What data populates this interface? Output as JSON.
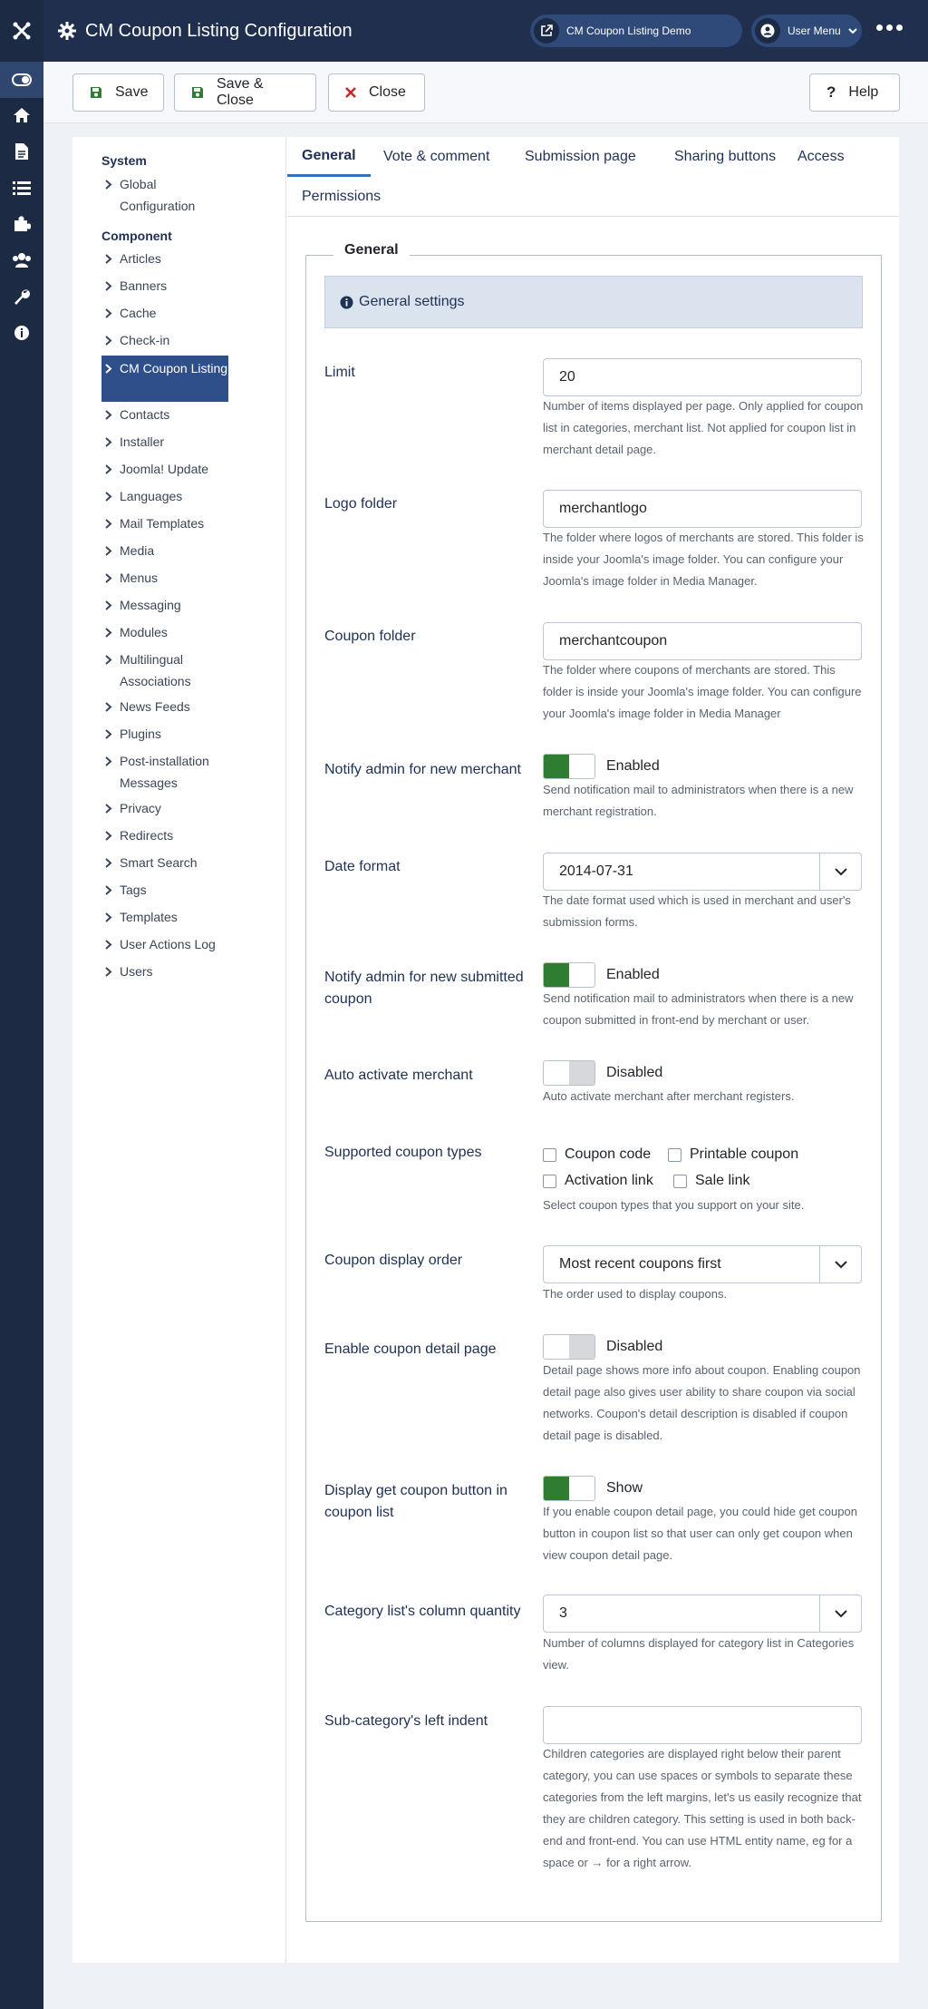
{
  "header": {
    "title": "CM Coupon Listing Configuration",
    "demo_link": "CM Coupon Listing Demo",
    "user_menu": "User Menu"
  },
  "toolbar": {
    "save": "Save",
    "save_close": "Save & Close",
    "close": "Close",
    "help": "Help"
  },
  "sidebar": {
    "system_heading": "System",
    "global_config": "Global Configuration",
    "component_heading": "Component",
    "items": [
      "Articles",
      "Banners",
      "Cache",
      "Check-in",
      "CM Coupon Listing",
      "Contacts",
      "Installer",
      "Joomla! Update",
      "Languages",
      "Mail Templates",
      "Media",
      "Menus",
      "Messaging",
      "Modules",
      "Multilingual Associations",
      "News Feeds",
      "Plugins",
      "Post-installation Messages",
      "Privacy",
      "Redirects",
      "Smart Search",
      "Tags",
      "Templates",
      "User Actions Log",
      "Users"
    ]
  },
  "tabs": [
    "General",
    "Vote & comment",
    "Submission page",
    "Sharing buttons",
    "Access",
    "Permissions"
  ],
  "form": {
    "legend": "General",
    "alert": "General settings",
    "limit": {
      "label": "Limit",
      "value": "20",
      "desc": "Number of items displayed per page. Only applied for coupon list in categories, merchant list. Not applied for coupon list in merchant detail page."
    },
    "logo_folder": {
      "label": "Logo folder",
      "value": "merchantlogo",
      "desc": "The folder where logos of merchants are stored. This folder is inside your Joomla's image folder. You can configure your Joomla's image folder in Media Manager."
    },
    "coupon_folder": {
      "label": "Coupon folder",
      "value": "merchantcoupon",
      "desc": "The folder where coupons of merchants are stored. This folder is inside your Joomla's image folder. You can configure your Joomla's image folder in Media Manager"
    },
    "notify_merchant": {
      "label": "Notify admin for new merchant",
      "state": "Enabled",
      "on": true,
      "desc": "Send notification mail to administrators when there is a new merchant registration."
    },
    "date_format": {
      "label": "Date format",
      "value": "2014-07-31",
      "desc": "The date format used which is used in merchant and user's submission forms."
    },
    "notify_coupon": {
      "label": "Notify admin for new submitted coupon",
      "state": "Enabled",
      "on": true,
      "desc": "Send notification mail to administrators when there is a new coupon submitted in front-end by merchant or user."
    },
    "auto_activate": {
      "label": "Auto activate merchant",
      "state": "Disabled",
      "on": false,
      "desc": "Auto activate merchant after merchant registers."
    },
    "coupon_types": {
      "label": "Supported coupon types",
      "options": [
        "Coupon code",
        "Printable coupon",
        "Activation link",
        "Sale link"
      ],
      "desc": "Select coupon types that you support on your site."
    },
    "display_order": {
      "label": "Coupon display order",
      "value": "Most recent coupons first",
      "desc": "The order used to display coupons."
    },
    "detail_page": {
      "label": "Enable coupon detail page",
      "state": "Disabled",
      "on": false,
      "desc": "Detail page shows more info about coupon. Enabling coupon detail page also gives user ability to share coupon via social networks. Coupon's detail description is disabled if coupon detail page is disabled."
    },
    "get_coupon_btn": {
      "label": "Display get coupon button in coupon list",
      "state": "Show",
      "on": true,
      "desc": "If you enable coupon detail page, you could hide get coupon button in coupon list so that user can only get coupon when view coupon detail page."
    },
    "column_qty": {
      "label": "Category list's column quantity",
      "value": "3",
      "desc": "Number of columns displayed for category list in Categories view."
    },
    "left_indent": {
      "label": "Sub-category's left indent",
      "value": "",
      "desc": "Children categories are displayed right below their parent category, you can use spaces or symbols to separate these categories from the left margins, let's us easily recognize that they are children category. This setting is used in both back-end and front-end. You can use HTML entity name, eg   for a space or → for a right arrow."
    }
  },
  "colors": {
    "header": "#1f2f4d",
    "rail": "#1d2a44",
    "active": "#2f4f8a",
    "toggle_on": "#2e7d32"
  }
}
